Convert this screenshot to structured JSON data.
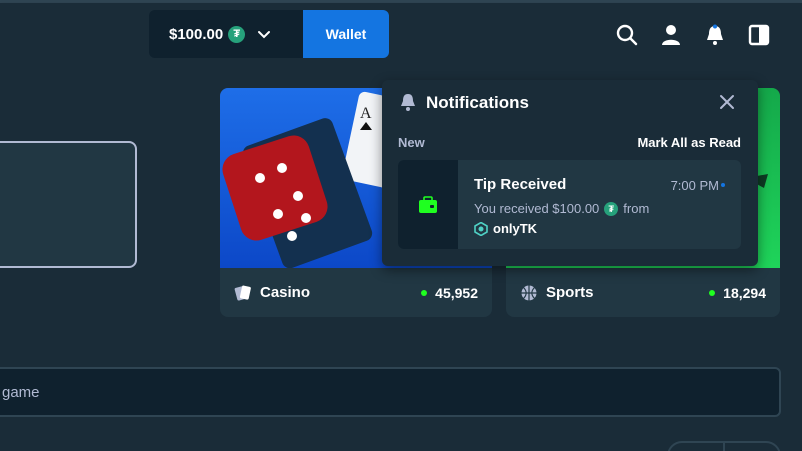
{
  "header": {
    "balance": "$100.00",
    "currency_symbol": "₮",
    "wallet_label": "Wallet"
  },
  "cards": [
    {
      "label": "Casino",
      "count": "45,952"
    },
    {
      "label": "Sports",
      "count": "18,294"
    }
  ],
  "search": {
    "text": "game"
  },
  "notifications": {
    "title": "Notifications",
    "section": "New",
    "mark_all": "Mark All as Read",
    "items": [
      {
        "title": "Tip Received",
        "time": "7:00 PM",
        "body_prefix": "You received $100.00",
        "body_suffix": "from",
        "user": "onlyTK"
      }
    ]
  },
  "colors": {
    "accent": "#1475e1",
    "background": "#1a2c38",
    "panel": "#213743",
    "online": "#1fff20",
    "tether": "#26a17b"
  }
}
